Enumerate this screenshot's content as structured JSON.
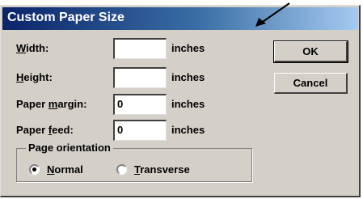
{
  "dialog": {
    "title": "Custom Paper Size",
    "fields": [
      {
        "label_pre": "",
        "label_u": "W",
        "label_post": "idth:",
        "value": "",
        "unit": "inches"
      },
      {
        "label_pre": "",
        "label_u": "H",
        "label_post": "eight:",
        "value": "",
        "unit": "inches"
      },
      {
        "label_pre": "Paper ",
        "label_u": "m",
        "label_post": "argin:",
        "value": "0",
        "unit": "inches"
      },
      {
        "label_pre": "Paper ",
        "label_u": "f",
        "label_post": "eed:",
        "value": "0",
        "unit": "inches"
      }
    ],
    "buttons": {
      "ok": "OK",
      "cancel": "Cancel"
    },
    "orientation": {
      "legend": "Page orientation",
      "normal_u": "N",
      "normal_rest": "ormal",
      "transverse_u": "T",
      "transverse_rest": "ransverse",
      "selected": "Normal"
    }
  },
  "colors": {
    "titlebar_start": "#0a246a",
    "titlebar_end": "#a6caf0",
    "face": "#d4d0c8"
  }
}
